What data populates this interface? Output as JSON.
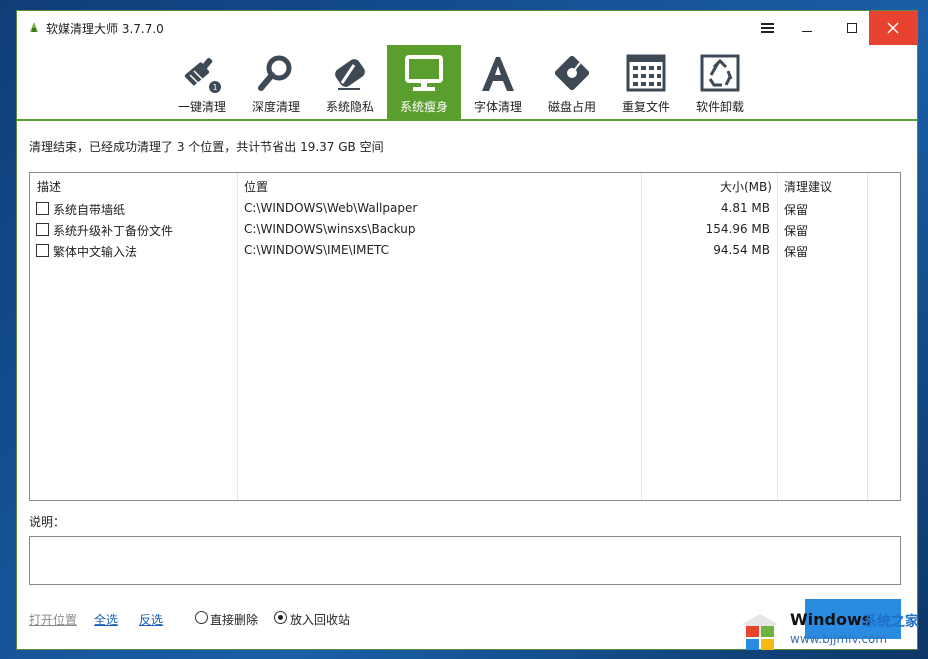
{
  "window": {
    "title": "软媒清理大师 3.7.7.0"
  },
  "toolbar": {
    "items": [
      {
        "label": "一键清理",
        "icon": "broom-icon",
        "active": false
      },
      {
        "label": "深度清理",
        "icon": "magnifier-icon",
        "active": false
      },
      {
        "label": "系统隐私",
        "icon": "eraser-icon",
        "active": false
      },
      {
        "label": "系统瘦身",
        "icon": "monitor-icon",
        "active": true
      },
      {
        "label": "字体清理",
        "icon": "font-a-icon",
        "active": false
      },
      {
        "label": "磁盘占用",
        "icon": "disk-tag-icon",
        "active": false
      },
      {
        "label": "重复文件",
        "icon": "duplicate-grid-icon",
        "active": false
      },
      {
        "label": "软件卸载",
        "icon": "recycle-icon",
        "active": false
      }
    ]
  },
  "status_text": "清理结束，已经成功清理了 3 个位置，共计节省出 19.37 GB 空间",
  "table": {
    "headers": [
      "描述",
      "位置",
      "大小(MB)",
      "清理建议"
    ],
    "rows": [
      {
        "desc": "系统自带墙纸",
        "location": "C:\\WINDOWS\\Web\\Wallpaper",
        "size": "4.81 MB",
        "advice": "保留",
        "checked": false
      },
      {
        "desc": "系统升级补丁备份文件",
        "location": "C:\\WINDOWS\\winsxs\\Backup",
        "size": "154.96 MB",
        "advice": "保留",
        "checked": false
      },
      {
        "desc": "繁体中文输入法",
        "location": "C:\\WINDOWS\\IME\\IMETC",
        "size": "94.54 MB",
        "advice": "保留",
        "checked": false
      }
    ]
  },
  "description_label": "说明：",
  "footer": {
    "open_location": "打开位置",
    "select_all": "全选",
    "invert": "反选",
    "delete_directly": "直接删除",
    "to_recycle_bin": "放入回收站",
    "selected_mode": "to_recycle_bin"
  },
  "watermark": {
    "brand": "Windows",
    "cn": "系统之家",
    "url": "www.bjjmlv.com"
  },
  "colors": {
    "accent_green": "#5a9e2d",
    "close_red": "#e84330",
    "link_blue": "#1a5fb4",
    "disabled_link": "#8a8a8a"
  }
}
